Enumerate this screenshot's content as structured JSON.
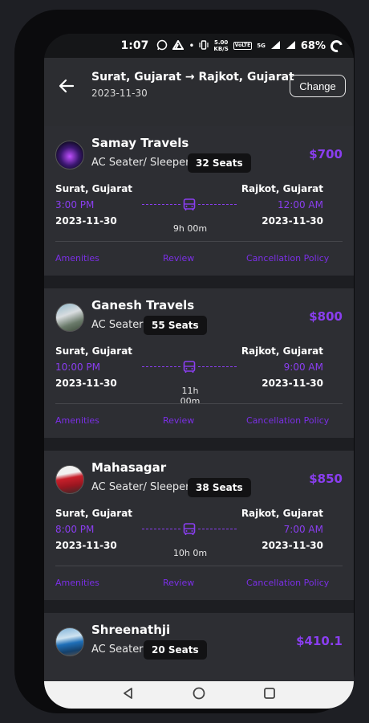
{
  "status": {
    "time": "1:07",
    "speed_top": "5.00",
    "speed_bottom": "KB/S",
    "volte": "VoLTE",
    "net": "5G",
    "battery": "68%"
  },
  "header": {
    "from": "Surat, Gujarat",
    "arrow": "→",
    "to": "Rajkot, Gujarat",
    "date": "2023-11-30",
    "change_label": "Change"
  },
  "colors": {
    "accent": "#8a3ef0",
    "card": "#2d2e33",
    "background": "#1d1e22"
  },
  "buses": [
    {
      "operator": "Samay Travels",
      "type": "AC Seater/ Sleeper",
      "seats": "32 Seats",
      "price": "$700",
      "from": "Surat, Gujarat",
      "to": "Rajkot, Gujarat",
      "dep_time": "3:00 PM",
      "arr_time": "12:00 AM",
      "dep_date": "2023-11-30",
      "arr_date": "2023-11-30",
      "duration": "9h 00m",
      "amenities": "Amenities",
      "review": "Review",
      "cancellation": "Cancellation Policy"
    },
    {
      "operator": "Ganesh Travels",
      "type": "AC Seater",
      "seats": "55 Seats",
      "price": "$800",
      "from": "Surat, Gujarat",
      "to": "Rajkot, Gujarat",
      "dep_time": "10:00 PM",
      "arr_time": "9:00 AM",
      "dep_date": "2023-11-30",
      "arr_date": "2023-11-30",
      "duration": "11h 00m",
      "amenities": "Amenities",
      "review": "Review",
      "cancellation": "Cancellation Policy"
    },
    {
      "operator": "Mahasagar",
      "type": "AC Seater/ Sleeper",
      "seats": "38 Seats",
      "price": "$850",
      "from": "Surat, Gujarat",
      "to": "Rajkot, Gujarat",
      "dep_time": "8:00 PM",
      "arr_time": "7:00 AM",
      "dep_date": "2023-11-30",
      "arr_date": "2023-11-30",
      "duration": "10h 0m",
      "amenities": "Amenities",
      "review": "Review",
      "cancellation": "Cancellation Policy"
    },
    {
      "operator": "Shreenathji",
      "type": "AC Seater",
      "seats": "20 Seats",
      "price": "$410.1"
    }
  ]
}
